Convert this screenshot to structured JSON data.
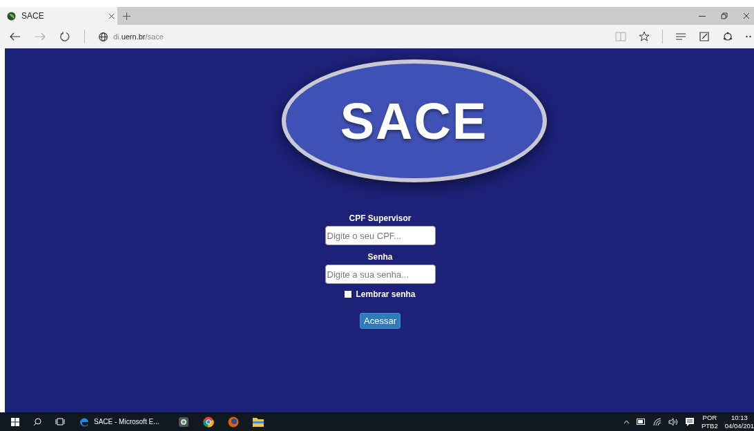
{
  "browser": {
    "tab": {
      "title": "SACE",
      "selected": true
    },
    "address": {
      "host_prefix": "di.",
      "host": "uern.br",
      "path": "/sace"
    }
  },
  "page": {
    "logo": "SACE",
    "form": {
      "fields": [
        {
          "label": "CPF Supervisor",
          "placeholder": "Digite o seu CPF..."
        },
        {
          "label": "Senha",
          "placeholder": "Digite a sua senha..."
        }
      ],
      "remember": {
        "label": "Lembrar senha",
        "checked": false
      },
      "submit": "Acessar"
    }
  },
  "taskbar": {
    "app": {
      "title": "SACE - Microsoft E..."
    },
    "language": "POR",
    "layout": "PTB2",
    "time": "10:13",
    "date": "04/04/201"
  }
}
